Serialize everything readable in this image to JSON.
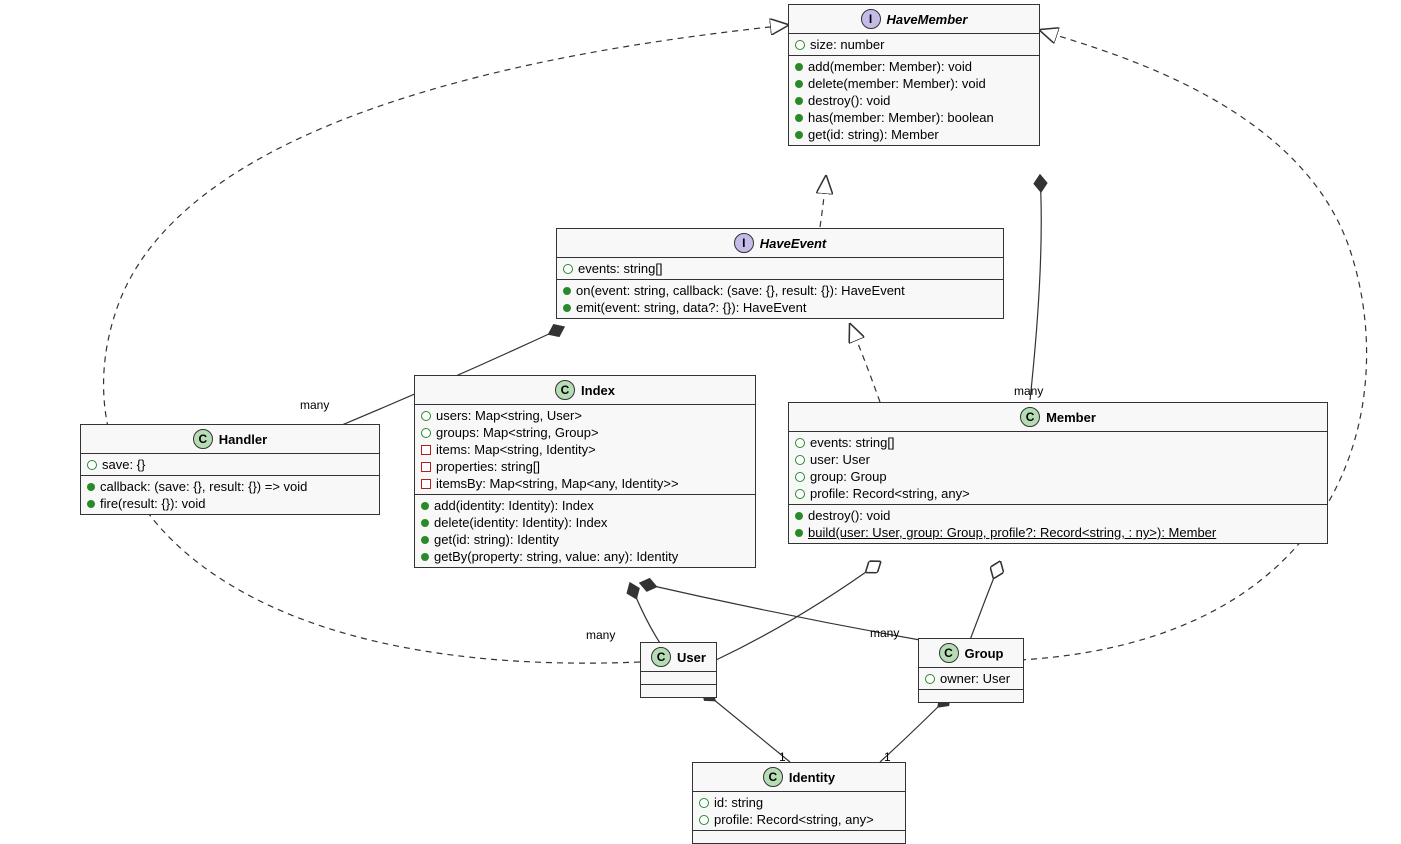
{
  "classes": {
    "HaveMember": {
      "stereotype": "I",
      "name": "HaveMember",
      "attrs": [
        {
          "vis": "open-green",
          "text": "size: number"
        }
      ],
      "ops": [
        {
          "vis": "filled-green",
          "text": "add(member: Member): void"
        },
        {
          "vis": "filled-green",
          "text": "delete(member: Member): void"
        },
        {
          "vis": "filled-green",
          "text": "destroy(): void"
        },
        {
          "vis": "filled-green",
          "text": "has(member: Member): boolean"
        },
        {
          "vis": "filled-green",
          "text": "get(id: string): Member"
        }
      ]
    },
    "HaveEvent": {
      "stereotype": "I",
      "name": "HaveEvent",
      "attrs": [
        {
          "vis": "open-green",
          "text": "events: string[]"
        }
      ],
      "ops": [
        {
          "vis": "filled-green",
          "text": "on(event: string, callback: (save: {}, result: {}): HaveEvent"
        },
        {
          "vis": "filled-green",
          "text": "emit(event: string, data?: {}): HaveEvent"
        }
      ]
    },
    "Index": {
      "stereotype": "C",
      "name": "Index",
      "attrs": [
        {
          "vis": "open-green",
          "text": "users: Map<string, User>"
        },
        {
          "vis": "open-green",
          "text": "groups: Map<string, Group>"
        },
        {
          "vis": "open-red",
          "text": "items: Map<string, Identity>"
        },
        {
          "vis": "open-red",
          "text": "properties: string[]"
        },
        {
          "vis": "open-red",
          "text": "itemsBy: Map<string, Map<any, Identity>>"
        }
      ],
      "ops": [
        {
          "vis": "filled-green",
          "text": "add(identity: Identity): Index"
        },
        {
          "vis": "filled-green",
          "text": "delete(identity: Identity): Index"
        },
        {
          "vis": "filled-green",
          "text": "get(id: string): Identity"
        },
        {
          "vis": "filled-green",
          "text": "getBy(property: string, value: any): Identity"
        }
      ]
    },
    "Handler": {
      "stereotype": "C",
      "name": "Handler",
      "attrs": [
        {
          "vis": "open-green",
          "text": "save: {}"
        }
      ],
      "ops": [
        {
          "vis": "filled-green",
          "text": "callback: (save: {}, result: {}) => void"
        },
        {
          "vis": "filled-green",
          "text": "fire(result: {}): void"
        }
      ]
    },
    "Member": {
      "stereotype": "C",
      "name": "Member",
      "attrs": [
        {
          "vis": "open-green",
          "text": "events: string[]"
        },
        {
          "vis": "open-green",
          "text": "user: User"
        },
        {
          "vis": "open-green",
          "text": "group: Group"
        },
        {
          "vis": "open-green",
          "text": "profile: Record<string, any>"
        }
      ],
      "ops": [
        {
          "vis": "filled-green",
          "text": "destroy(): void"
        },
        {
          "vis": "filled-green",
          "text": "build(user: User, group: Group, profile?: Record<string, : ny>): Member",
          "underline": true
        }
      ]
    },
    "User": {
      "stereotype": "C",
      "name": "User",
      "attrs": [],
      "ops": []
    },
    "Group": {
      "stereotype": "C",
      "name": "Group",
      "attrs": [
        {
          "vis": "open-green",
          "text": "owner: User"
        }
      ],
      "ops": []
    },
    "Identity": {
      "stereotype": "C",
      "name": "Identity",
      "attrs": [
        {
          "vis": "open-green",
          "text": "id: string"
        },
        {
          "vis": "open-green",
          "text": "profile: Record<string, any>"
        }
      ],
      "ops": []
    }
  },
  "labels": {
    "handler_many": "many",
    "member_many": "many",
    "user_many": "many",
    "group_many": "many",
    "user_one": "1",
    "group_one": "1"
  }
}
